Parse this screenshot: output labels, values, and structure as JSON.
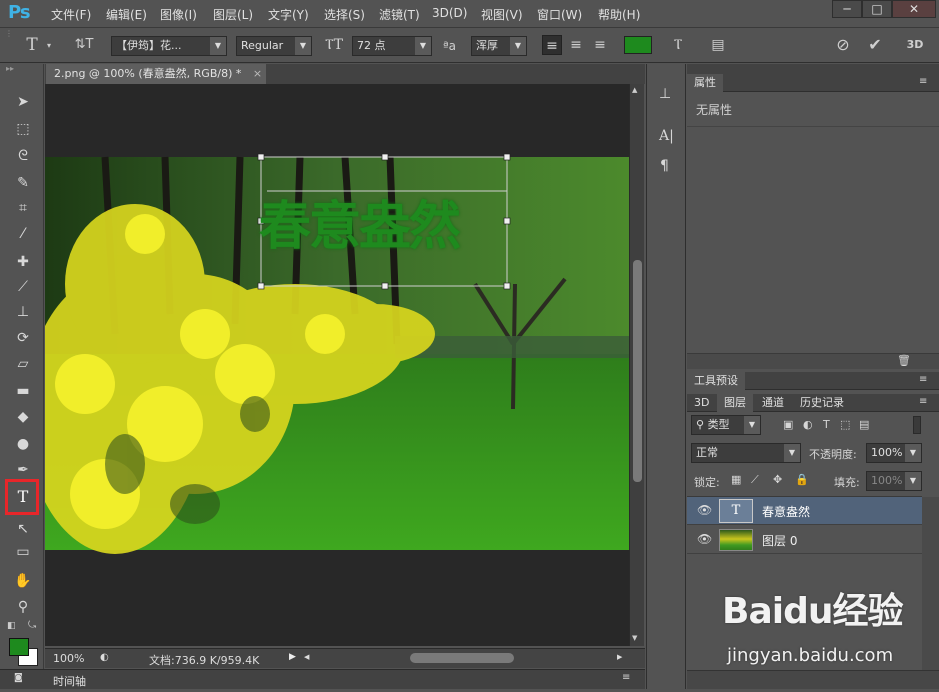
{
  "app": {
    "logo": "Ps"
  },
  "menu": [
    "文件(F)",
    "编辑(E)",
    "图像(I)",
    "图层(L)",
    "文字(Y)",
    "选择(S)",
    "滤镜(T)",
    "3D(D)",
    "视图(V)",
    "窗口(W)",
    "帮助(H)"
  ],
  "options": {
    "font_family": "【伊筠】花...",
    "font_style": "Regular",
    "font_size": "72 点",
    "aa_label": "ªa",
    "antialias": "浑厚",
    "text_color": "#1e8a1e"
  },
  "document": {
    "tab_title": "2.png @ 100% (春意盎然, RGB/8) *",
    "canvas_text": "春意盎然",
    "zoom": "100%",
    "doc_size": "文档:736.9 K/959.4K"
  },
  "timeline_label": "时间轴",
  "properties": {
    "tab": "属性",
    "empty": "无属性"
  },
  "tool_presets_tab": "工具预设",
  "layers": {
    "tabs": [
      "3D",
      "图层",
      "通道",
      "历史记录"
    ],
    "filter_kind": "类型",
    "blend_mode": "正常",
    "opacity_label": "不透明度:",
    "opacity": "100%",
    "lock_label": "锁定:",
    "fill_label": "填充:",
    "fill": "100%",
    "items": [
      {
        "name": "春意盎然",
        "thumb": "T"
      },
      {
        "name": "图层 0"
      }
    ]
  },
  "colors": {
    "foreground": "#1e8a1e",
    "background": "#ffffff",
    "highlight": "#e8262a"
  },
  "watermark": {
    "brand": "Baidu经验",
    "url": "jingyan.baidu.com"
  }
}
